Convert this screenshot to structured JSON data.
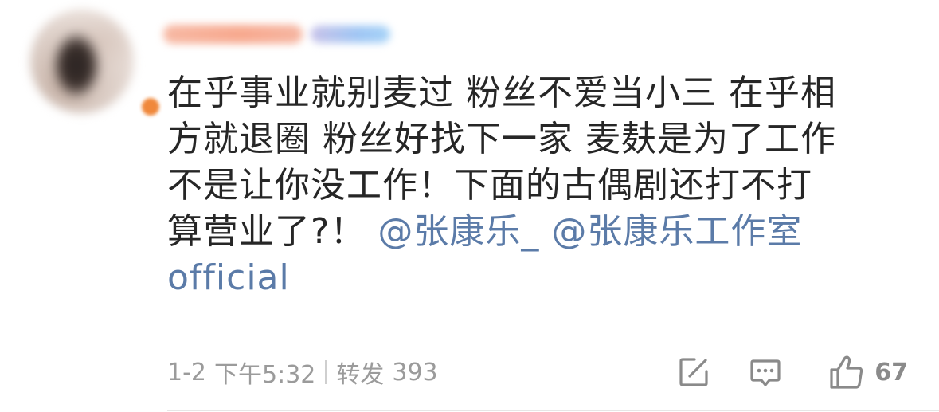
{
  "comment": {
    "avatar_icon": "blurred-user-photo",
    "badge_color": "#f0883b",
    "username_blurred": true,
    "lines": [
      "在乎事业就别麦过 粉丝不爱当小三 在乎相",
      "方就退圈 粉丝好找下一家 麦麸是为了工作",
      "不是让你没工作！下面的古偶剧还打不打",
      "算营业了?！"
    ],
    "mention_1": "@张康乐_",
    "mention_2": "@张康乐工作室",
    "mention_2_cont": "official",
    "mention_color": "#5b7ba8",
    "text_color": "#262626"
  },
  "footer": {
    "date": "1-2",
    "time": "下午5:32",
    "repost_label": "转发",
    "repost_count": "393",
    "share_icon": "share-edit-icon",
    "reply_icon": "comment-icon",
    "like_icon": "thumbs-up-icon",
    "like_count": "67"
  }
}
